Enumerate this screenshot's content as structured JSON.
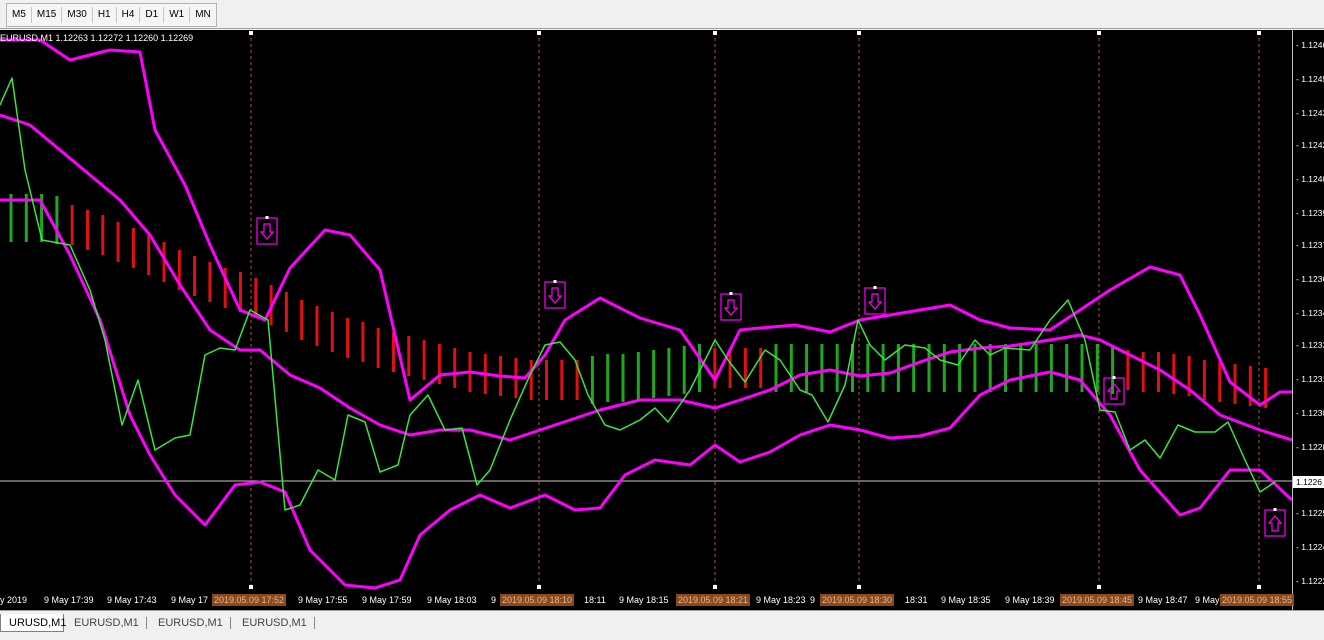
{
  "toolbar": {
    "timeframes": [
      "M5",
      "M15",
      "M30",
      "H1",
      "H4",
      "D1",
      "W1",
      "MN"
    ]
  },
  "chart": {
    "info": "EURUSD,M1  1.12263 1.12272 1.12260 1.12269",
    "current_price": "1.1226",
    "price_scale": [
      "1.1246",
      "1.1245",
      "1.1243",
      "1.1242",
      "1.1240",
      "1.1239",
      "1.1237",
      "1.1236",
      "1.1234",
      "1.1233",
      "1.1231",
      "1.1230",
      "1.1228",
      "1.1225",
      "1.1224",
      "1.1222"
    ],
    "time_axis": [
      "y 2019",
      "9 May 17:39",
      "9 May 17:43",
      "9 May 17",
      "9 May 17:55",
      "9 May 17:59",
      "9 May 18:03",
      "9",
      "18:11",
      "9 May 18:15",
      "9 May 18:23",
      "9",
      "18:31",
      "9 May 18:35",
      "9 May 18:39",
      "9 May 18:47",
      "9 May",
      "55"
    ],
    "vline_tags": [
      "2019.05.09 17:52",
      "2019.05.09 18:10",
      "2019.05.09 18:21",
      "2019.05.09 18:30",
      "2019.05.09 18:45",
      "2019.05.09 18:55"
    ],
    "colors": {
      "background": "#000000",
      "bands": "#ff00ff",
      "price_line": "#39e639",
      "histogram_up": "#1fa81f",
      "histogram_down": "#e01010",
      "vlines": "#c87a3c",
      "signal_box": "#ff00ff"
    },
    "signals": [
      {
        "direction": "down",
        "icon": "down-arrow-icon"
      },
      {
        "direction": "down",
        "icon": "down-arrow-icon"
      },
      {
        "direction": "down",
        "icon": "down-arrow-icon"
      },
      {
        "direction": "down",
        "icon": "down-arrow-icon"
      },
      {
        "direction": "up",
        "icon": "up-arrow-icon"
      },
      {
        "direction": "up",
        "icon": "up-arrow-icon"
      }
    ]
  },
  "tabs": [
    "URUSD,M1",
    "EURUSD,M1",
    "EURUSD,M1",
    "EURUSD,M1"
  ]
}
